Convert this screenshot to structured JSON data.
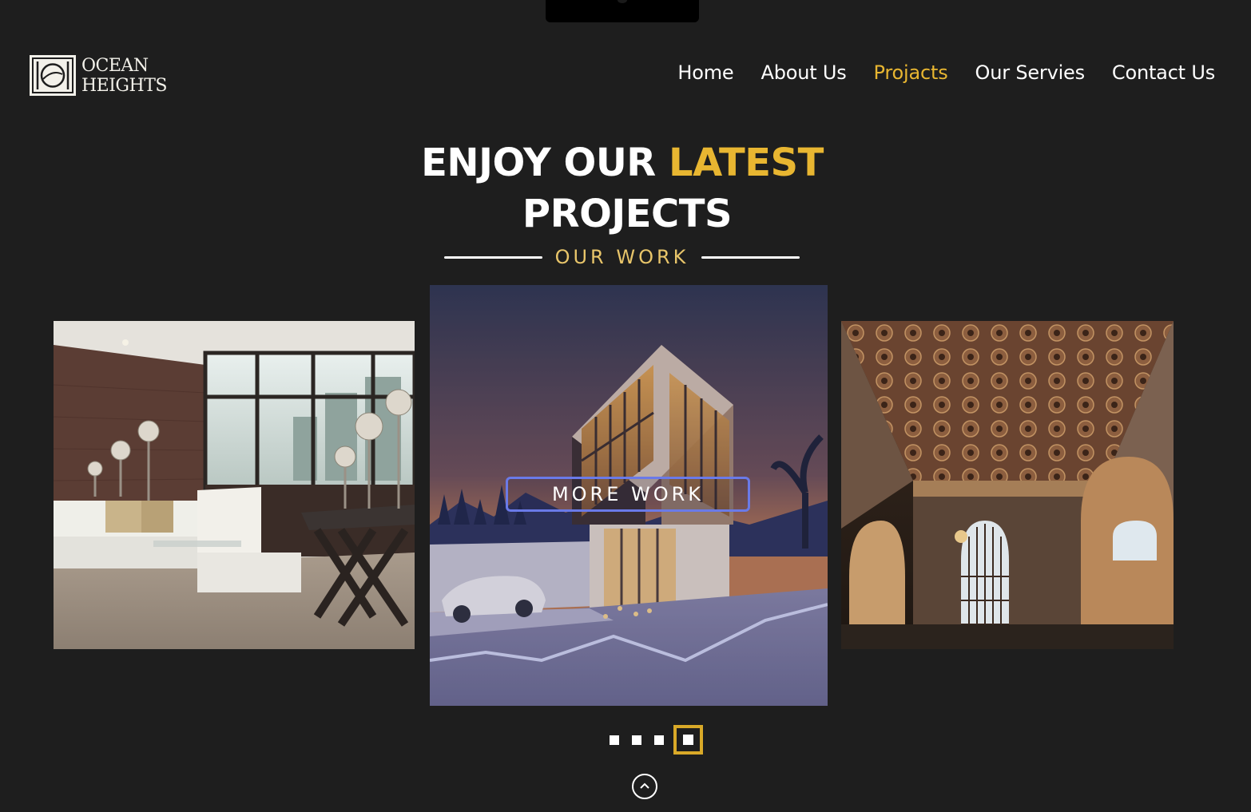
{
  "brand": {
    "line1": "OCEAN",
    "line2": "HEIGHTS",
    "icon": "ocean-heights-logo-icon"
  },
  "nav": {
    "items": [
      {
        "label": "Home",
        "active": false
      },
      {
        "label": "About Us",
        "active": false
      },
      {
        "label": "Projacts",
        "active": true
      },
      {
        "label": "Our Servies",
        "active": false
      },
      {
        "label": "Contact Us",
        "active": false
      }
    ]
  },
  "hero": {
    "heading_part1": "ENJOY OUR ",
    "heading_highlight": "LATEST",
    "heading_line2": "PROJECTS",
    "subheading": "OUR WORK"
  },
  "carousel": {
    "more_button_label": "MORE WORK",
    "slides": [
      {
        "description_icon": "living-room-image"
      },
      {
        "description_icon": "modern-house-image"
      },
      {
        "description_icon": "ornate-hall-image"
      }
    ],
    "dot_count": 4,
    "active_dot": 4
  },
  "scroll_top_icon": "chevron-up-icon",
  "colors": {
    "background": "#1e1e1e",
    "accent": "#e8b631",
    "button_border": "#6a7ae8"
  }
}
